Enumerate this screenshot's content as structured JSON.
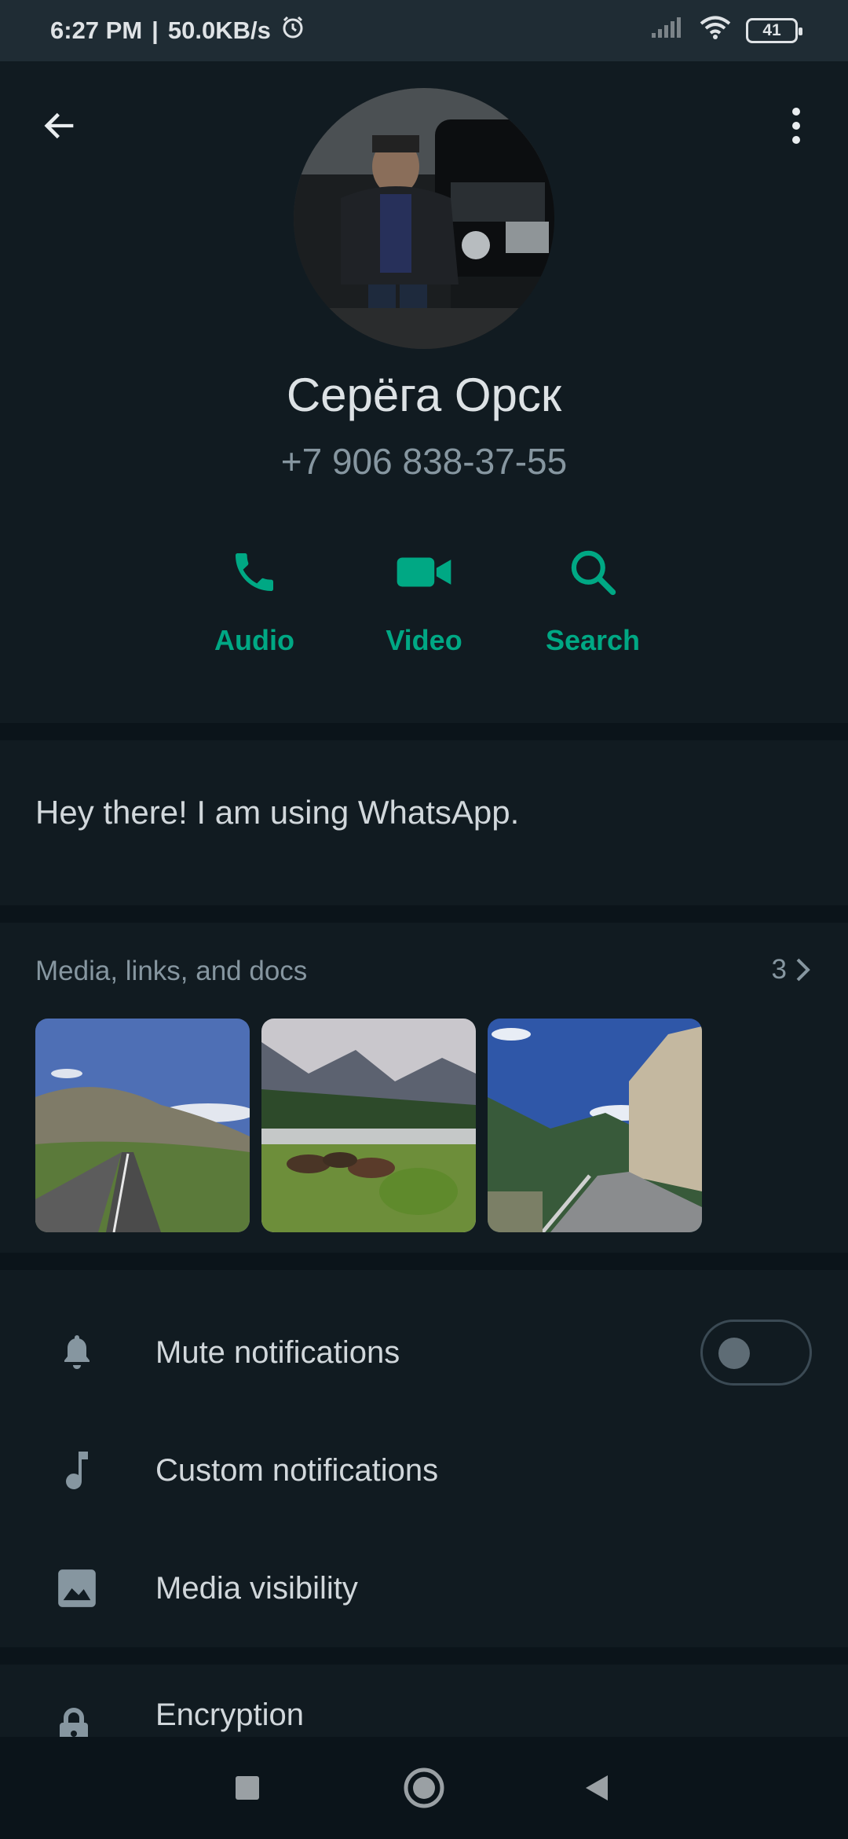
{
  "status_bar": {
    "time": "6:27 PM",
    "separator": "|",
    "net_speed": "50.0KB/s",
    "battery": "41"
  },
  "contact": {
    "name": "Серёга Орск",
    "phone": "+7 906 838-37-55"
  },
  "actions": [
    {
      "label": "Audio",
      "icon": "phone-icon"
    },
    {
      "label": "Video",
      "icon": "video-icon"
    },
    {
      "label": "Search",
      "icon": "search-icon"
    }
  ],
  "about": {
    "text": "Hey there! I am using WhatsApp."
  },
  "media": {
    "title": "Media, links, and docs",
    "count": "3"
  },
  "settings": {
    "mute": {
      "label": "Mute notifications",
      "enabled": false
    },
    "custom": {
      "label": "Custom notifications"
    },
    "visibility": {
      "label": "Media visibility"
    },
    "encryption": {
      "label": "Encryption"
    }
  },
  "colors": {
    "accent": "#00a884",
    "background": "#111b21",
    "divider": "#0b141a",
    "secondary_text": "#8696a0"
  }
}
